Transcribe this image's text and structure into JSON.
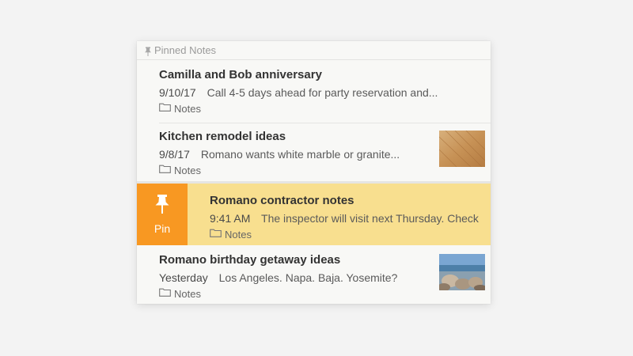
{
  "section": {
    "title": "Pinned Notes",
    "icon": "pin-icon"
  },
  "notes": [
    {
      "title": "Camilla and Bob anniversary",
      "date": "9/10/17",
      "preview": "Call 4-5 days ahead for party reservation and...",
      "folder": "Notes",
      "thumbnail": null
    },
    {
      "title": "Kitchen remodel ideas",
      "date": "9/8/17",
      "preview": "Romano wants white marble or granite...",
      "folder": "Notes",
      "thumbnail": "wood-floor-image"
    },
    {
      "title": "Romano contractor notes",
      "date": "9:41 AM",
      "preview": "The inspector will visit next Thursday. Check",
      "folder": "Notes",
      "thumbnail": null,
      "swiped": true
    },
    {
      "title": "Romano birthday getaway ideas",
      "date": "Yesterday",
      "preview": "Los Angeles. Napa. Baja. Yosemite?",
      "folder": "Notes",
      "thumbnail": "beach-image"
    }
  ],
  "swipe_action": {
    "label": "Pin",
    "icon": "pin-icon",
    "color": "#f89822"
  },
  "colors": {
    "highlight": "#f8df8f",
    "background": "#f8f8f6"
  }
}
